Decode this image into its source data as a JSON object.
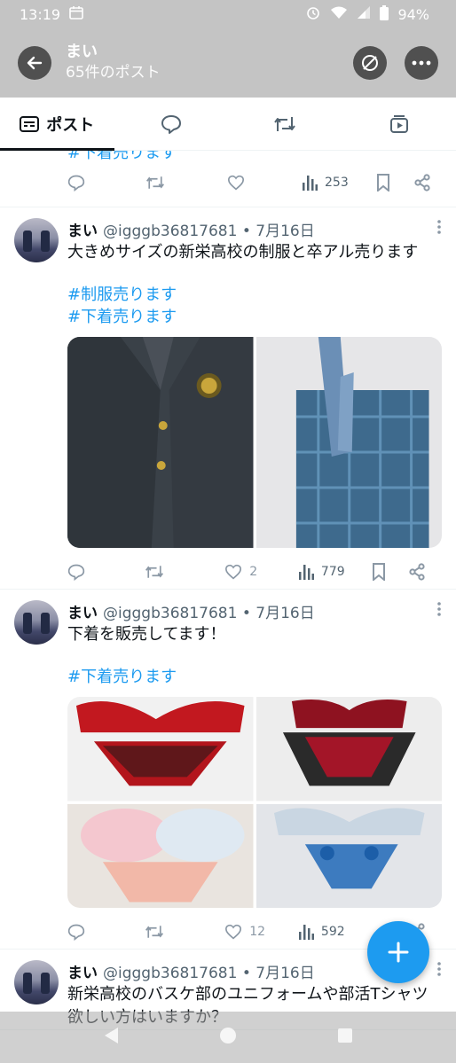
{
  "status_bar": {
    "time": "13:19",
    "battery": "94%"
  },
  "header": {
    "title": "まい",
    "subtitle": "65件のポスト"
  },
  "tabs": [
    {
      "label": "ポスト",
      "icon": "post-icon"
    },
    {
      "label": "",
      "icon": "reply-icon"
    },
    {
      "label": "",
      "icon": "repost-icon"
    },
    {
      "label": "",
      "icon": "media-icon"
    }
  ],
  "partial_post": {
    "tag": "#下着売ります",
    "views": "253"
  },
  "tweets": [
    {
      "name": "まい",
      "handle": "@igggb36817681",
      "date": "7月16日",
      "text": "大きめサイズの新栄高校の制服と卒アル売ります",
      "tags": [
        "#制服売ります",
        "#下着売ります"
      ],
      "likes": "2",
      "views": "779"
    },
    {
      "name": "まい",
      "handle": "@igggb36817681",
      "date": "7月16日",
      "text": "下着を販売してます！",
      "tags": [
        "#下着売ります"
      ],
      "likes": "12",
      "views": "592"
    },
    {
      "name": "まい",
      "handle": "@igggb36817681",
      "date": "7月16日",
      "text": "新栄高校のバスケ部のユニフォームや部活Tシャツ欲しい方はいますか？",
      "tags": [],
      "likes": "",
      "views": ""
    }
  ],
  "colors": {
    "accent": "#1d9bf0",
    "header_bg": "#c4c4c4",
    "muted": "#536471"
  }
}
